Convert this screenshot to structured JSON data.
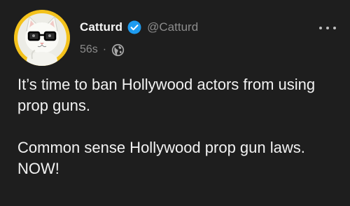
{
  "post": {
    "author": {
      "display_name": "Catturd",
      "handle": "@Catturd",
      "verified": true
    },
    "timestamp": "56s",
    "separator": "·",
    "visibility_icon": "globe-icon",
    "more_icon": "more-options-icon",
    "text": {
      "paragraph_1": "It’s time to ban Hollywood actors from using prop guns.",
      "paragraph_2": "Common sense Hollywood prop gun laws. NOW!"
    }
  },
  "colors": {
    "background": "#1e1e1e",
    "text": "#f2f2f2",
    "muted": "#8c8c8c",
    "verified_badge": "#1d9bf0",
    "avatar_ring": "#f4c21b"
  }
}
